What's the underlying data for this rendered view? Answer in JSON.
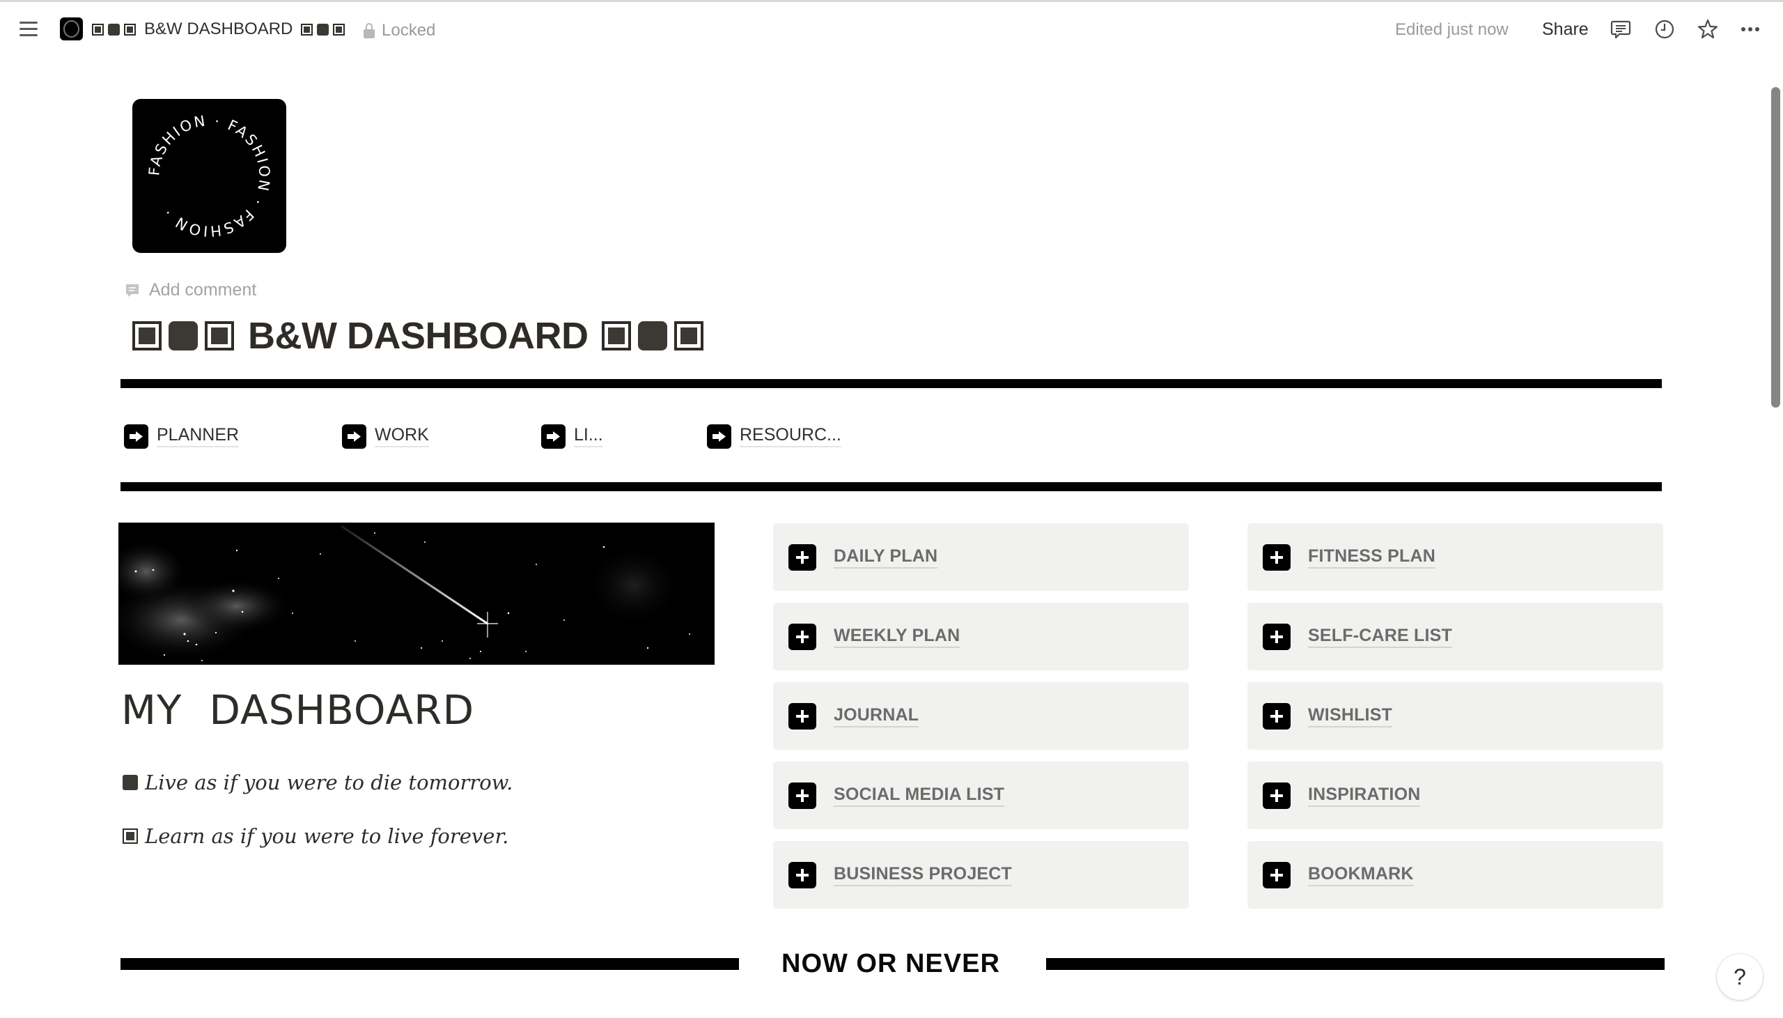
{
  "topbar": {
    "breadcrumb_title": "B&W DASHBOARD",
    "lock_label": "Locked",
    "edited_label": "Edited just now",
    "share_label": "Share",
    "icons": [
      "menu-icon",
      "page-icon",
      "lock-icon",
      "comment-icon",
      "clock-icon",
      "star-icon",
      "more-icon"
    ]
  },
  "page": {
    "icon_text": "FASHION · FASHION · FASHION ·",
    "add_comment_label": "Add comment",
    "title": "B&W DASHBOARD",
    "title_decor": [
      "square-outline",
      "square-solid",
      "square-outline"
    ]
  },
  "nav": {
    "links": [
      {
        "label": "PLANNER"
      },
      {
        "label": "WORK"
      },
      {
        "label": "LI..."
      },
      {
        "label": "RESOURC..."
      }
    ]
  },
  "left": {
    "heading": "MY  DASHBOARD",
    "quotes": [
      {
        "bullet": "square-solid",
        "text": "Live as if you were to die tomorrow."
      },
      {
        "bullet": "square-outline",
        "text": "Learn as if you were to live forever."
      }
    ]
  },
  "cards": {
    "column1": [
      {
        "label": "DAILY PLAN"
      },
      {
        "label": "WEEKLY PLAN"
      },
      {
        "label": "JOURNAL"
      },
      {
        "label": "SOCIAL MEDIA LIST"
      },
      {
        "label": "BUSINESS PROJECT"
      }
    ],
    "column2": [
      {
        "label": "FITNESS PLAN"
      },
      {
        "label": "SELF-CARE LIST"
      },
      {
        "label": "WISHLIST"
      },
      {
        "label": "INSPIRATION"
      },
      {
        "label": "BOOKMARK"
      }
    ]
  },
  "footer": {
    "section_label": "NOW OR NEVER",
    "help_label": "?"
  },
  "colors": {
    "accent": "#000000",
    "card_bg": "#f1f1ef",
    "text": "#37352f",
    "muted": "#9b9a97"
  }
}
